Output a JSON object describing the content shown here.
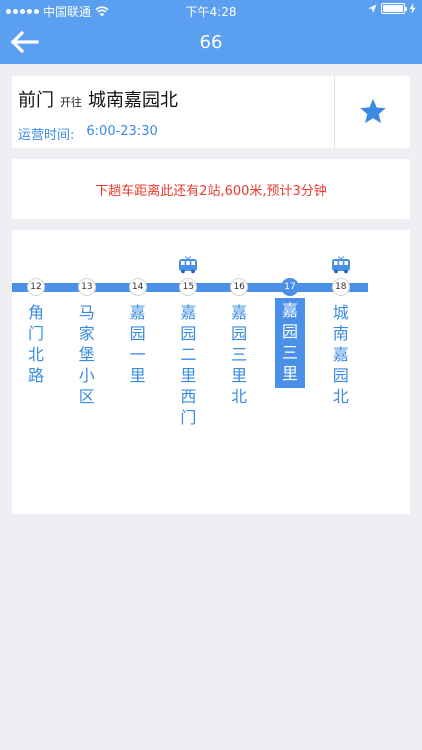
{
  "status_bar": {
    "carrier": "中国联通",
    "time": "下午4:28",
    "battery_level": 1.0
  },
  "nav": {
    "title": "66",
    "back_icon": "back-arrow-icon"
  },
  "route": {
    "from": "前门",
    "via": "开往",
    "to": "城南嘉园北",
    "hours_label": "运营时间:",
    "hours_value": "6:00-23:30",
    "favorite_icon": "star-icon"
  },
  "arrival": {
    "message": "下趟车距离此还有2站,600米,预计3分钟"
  },
  "stops": [
    {
      "num": "12",
      "name": "角门北路"
    },
    {
      "num": "13",
      "name": "马家堡小区"
    },
    {
      "num": "14",
      "name": "嘉园一里"
    },
    {
      "num": "15",
      "name": "嘉园二里西门"
    },
    {
      "num": "16",
      "name": "嘉园三里北"
    },
    {
      "num": "17",
      "name": "嘉园三里"
    },
    {
      "num": "18",
      "name": "城南嘉园北"
    }
  ],
  "current_stop_index": 5,
  "buses_at_stop_indexes": [
    3,
    6
  ],
  "colors": {
    "header": "#5b9ff0",
    "route_bar": "#4a90e8",
    "stop_text": "#3a8be0",
    "arrival_text": "#e83a2e",
    "background": "#eeeef3"
  }
}
